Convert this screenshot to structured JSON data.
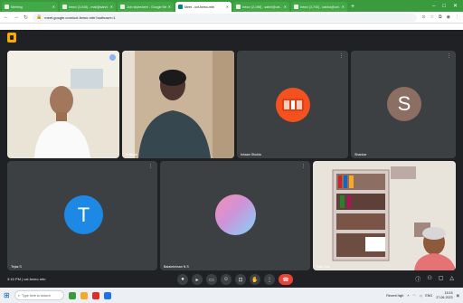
{
  "browser": {
    "tabs": [
      {
        "title": "Meeting",
        "active": false
      },
      {
        "title": "Inbox (3,045) - mail@sahni...",
        "active": false
      },
      {
        "title": "Join stylesheet - Google Meet",
        "active": false
      },
      {
        "title": "Meet - uxt-fwmo-mtn",
        "active": true
      },
      {
        "title": "Inbox (2,198) - sahni@uxt...",
        "active": false
      },
      {
        "title": "Inbox (3,740) - kanha@uxt...",
        "active": false
      }
    ],
    "url": "meet.google.com/uxt-fwmo-mtn?authuser=1",
    "new_tab_glyph": "+",
    "window_controls": [
      "–",
      "□",
      "✕"
    ]
  },
  "participants": [
    {
      "name": "",
      "type": "video",
      "presenting": true
    },
    {
      "name": "Prakash",
      "type": "video"
    },
    {
      "name": "Ishaan Shukla",
      "type": "avatar",
      "initial": "",
      "color": "#f4511e",
      "avatar_style": "image"
    },
    {
      "name": "Shankar",
      "type": "avatar",
      "initial": "S",
      "color": "#8d6e63"
    },
    {
      "name": "Tejas S",
      "type": "avatar",
      "initial": "T",
      "color": "#1e88e5"
    },
    {
      "name": "Balakrishnan N S",
      "type": "avatar",
      "initial": "",
      "color": "#f48fb1",
      "avatar_style": "gradient"
    },
    {
      "name": "Ravi Das",
      "type": "video"
    }
  ],
  "bottom": {
    "time": "3:15 PM",
    "separator": "|",
    "meeting_code": "uxt-fwmo-mtn",
    "controls": [
      "mic-icon",
      "camera-icon",
      "captions-icon",
      "emoji-icon",
      "present-icon",
      "hand-icon",
      "more-icon"
    ],
    "end_call_icon": "call-end-icon",
    "right_controls": [
      "info-icon",
      "people-icon",
      "chat-icon",
      "activities-icon"
    ]
  },
  "taskbar": {
    "search_placeholder": "Type here to search",
    "weather": "Recent high",
    "time": "15:15",
    "date": "27-06-2023",
    "lang": "ENG"
  },
  "colors": {
    "tab_strip": "#3a9a3e",
    "tile": "#3c4043",
    "end_call": "#ea4335",
    "meet_bg": "#202124"
  }
}
